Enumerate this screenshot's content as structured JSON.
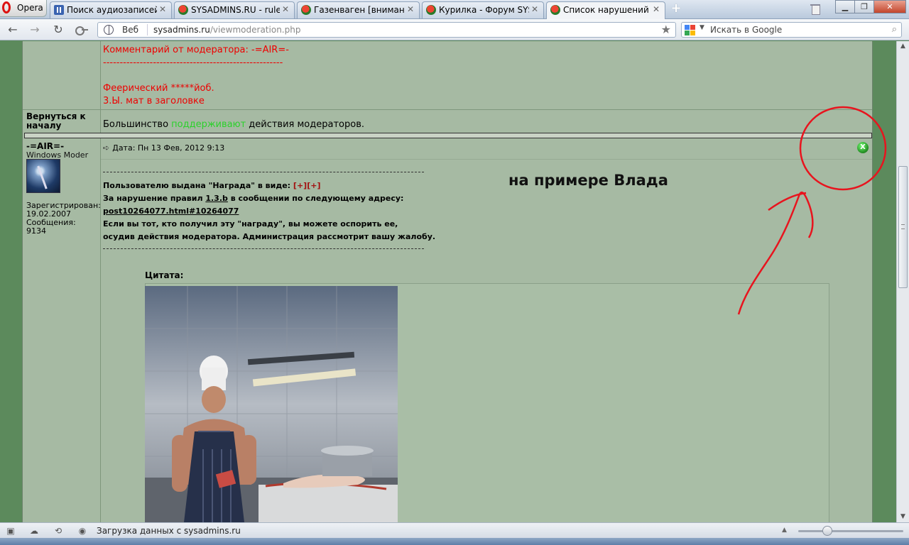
{
  "browser": {
    "menu_label": "Opera",
    "tabs": [
      {
        "label": "Поиск аудиозаписей ...",
        "icon": "pause-icon",
        "active": false
      },
      {
        "label": "SYSADMINS.RU - rules",
        "icon": "sysadmins-favicon",
        "active": false
      },
      {
        "label": "Газенваген [внимание...",
        "icon": "sysadmins-favicon",
        "active": false
      },
      {
        "label": "Курилка - Форум SYS...",
        "icon": "sysadmins-favicon",
        "active": false
      },
      {
        "label": "Список нарушений",
        "icon": "sysadmins-favicon",
        "active": true
      }
    ],
    "address": {
      "scheme_label": "Веб",
      "host": "sysadmins.ru",
      "path": "/viewmoderation.php"
    },
    "search": {
      "placeholder": "Искать в Google"
    },
    "status": {
      "message": "Загрузка данных с sysadmins.ru"
    }
  },
  "prev_post": {
    "moderator_comment": "Комментарий от модератора: -=AIR=-",
    "separator": "------------------------------------------------------",
    "lines": [
      "Феерический *****йоб.",
      "3.Ы. мат в заголовке"
    ]
  },
  "back_to_top": "Вернуться к началу",
  "majority": {
    "before": "Большинство ",
    "highlight": "поддерживают",
    "after": " действия модераторов."
  },
  "post": {
    "author": "-=AIR=-",
    "role": "Windows Moder",
    "registered_label": "Зарегистрирован:",
    "registered_date": "19.02.2007",
    "messages_label": "Сообщения:",
    "messages_count": "9134",
    "date": "Дата: Пн 13 Фев, 2012 9:13",
    "award_line": "Пользователю выдана \"Награда\" в виде:",
    "award_value": "[+][+]",
    "violation_prefix": "За нарушение правил",
    "rule": "1.3.b",
    "violation_suffix": "в сообщении по следующему адресу:",
    "link": "post10264077.html#10264077",
    "appeal_1": "Если вы тот, кто получил эту \"награду\", вы можете оспорить ее,",
    "appeal_2": "осудив действия модератора. Администрация рассмотрит вашу жалобу.",
    "quote_label": "Цитата:",
    "close_icon_label": "X"
  },
  "annotation": {
    "text": "на примере Влада",
    "color": "#e8141e"
  }
}
